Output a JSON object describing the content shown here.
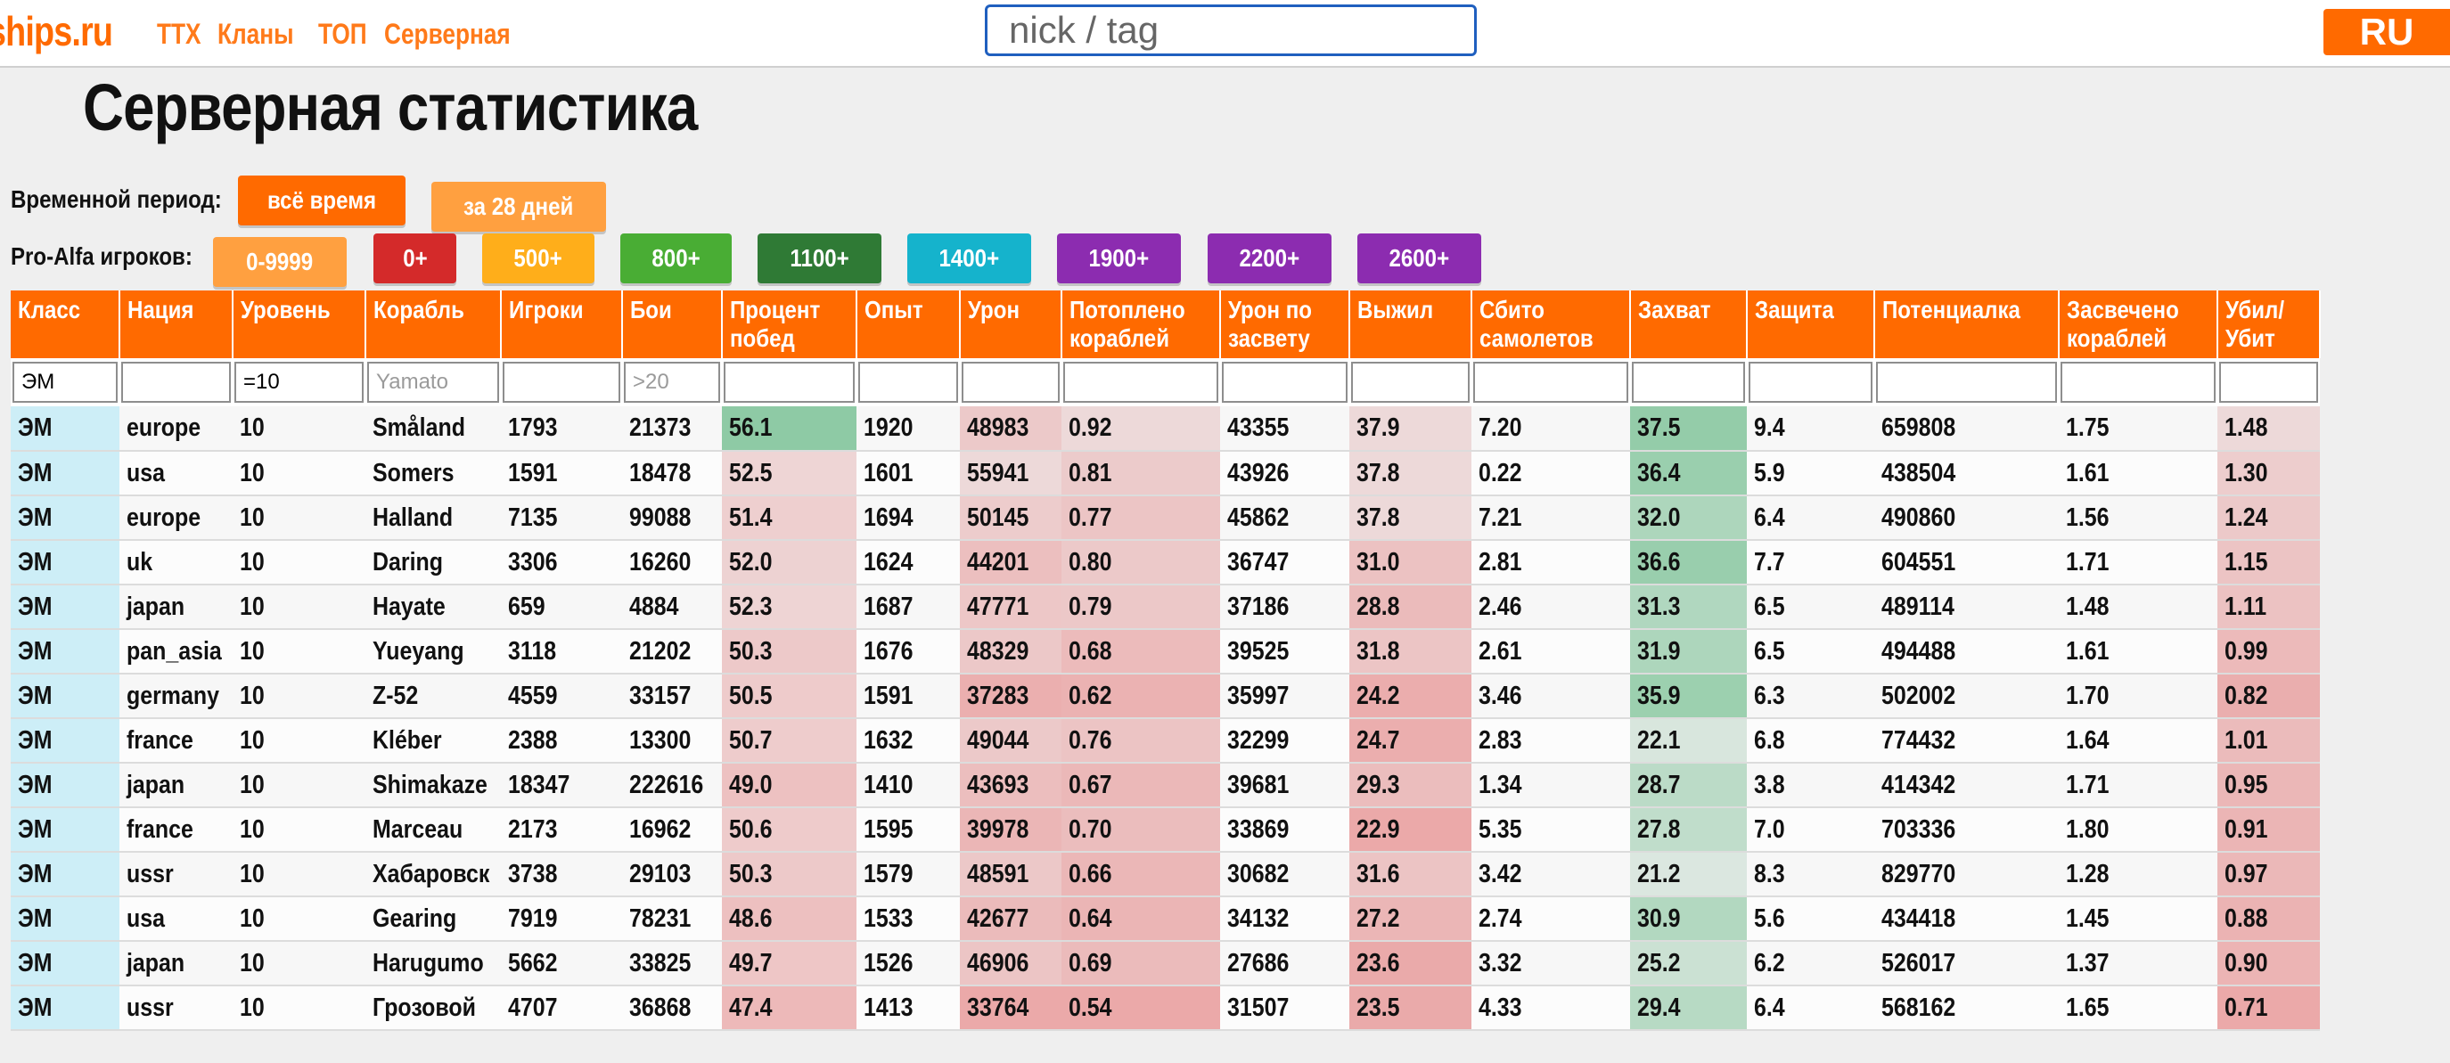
{
  "header": {
    "logo": "ships.ru",
    "nav": [
      "ТТХ",
      "Кланы",
      "ТОП",
      "Серверная"
    ],
    "search_placeholder": "nick / tag",
    "lang": "RU"
  },
  "page_title": "Серверная статистика",
  "period": {
    "label": "Временной период:",
    "options": [
      {
        "label": "всё время",
        "color": "#ff6a00",
        "selected": true
      },
      {
        "label": "за 28 дней",
        "color": "#ffa040",
        "selected": false
      }
    ]
  },
  "players": {
    "label": "Pro-Alfa игроков:",
    "options": [
      {
        "label": "0-9999",
        "color": "#ffa040"
      },
      {
        "label": "0+",
        "color": "#d42a2a"
      },
      {
        "label": "500+",
        "color": "#ffae1a"
      },
      {
        "label": "800+",
        "color": "#49ad34"
      },
      {
        "label": "1100+",
        "color": "#2f7a35"
      },
      {
        "label": "1400+",
        "color": "#15b3cc"
      },
      {
        "label": "1900+",
        "color": "#8c2cb0"
      },
      {
        "label": "2200+",
        "color": "#8c2cb0"
      },
      {
        "label": "2600+",
        "color": "#8c2cb0"
      }
    ]
  },
  "table": {
    "columns": [
      "Класс",
      "Нация",
      "Уровень",
      "Корабль",
      "Игроки",
      "Бои",
      "Процент побед",
      "Опыт",
      "Урон",
      "Потоплено кораблей",
      "Урон по засвету",
      "Выжил",
      "Сбито самолетов",
      "Захват",
      "Защита",
      "Потенциалка",
      "Засвечено кораблей",
      "Убил/ Убит"
    ],
    "filters": [
      {
        "value": "ЭМ",
        "placeholder": ""
      },
      {
        "value": "",
        "placeholder": ""
      },
      {
        "value": "=10",
        "placeholder": ""
      },
      {
        "value": "",
        "placeholder": "Yamato"
      },
      {
        "value": "",
        "placeholder": ""
      },
      {
        "value": "",
        "placeholder": ">20"
      },
      {
        "value": "",
        "placeholder": ""
      },
      {
        "value": "",
        "placeholder": ""
      },
      {
        "value": "",
        "placeholder": ""
      },
      {
        "value": "",
        "placeholder": ""
      },
      {
        "value": "",
        "placeholder": ""
      },
      {
        "value": "",
        "placeholder": ""
      },
      {
        "value": "",
        "placeholder": ""
      },
      {
        "value": "",
        "placeholder": ""
      },
      {
        "value": "",
        "placeholder": ""
      },
      {
        "value": "",
        "placeholder": ""
      },
      {
        "value": "",
        "placeholder": ""
      },
      {
        "value": "",
        "placeholder": ""
      }
    ],
    "rows": [
      [
        "ЭМ",
        "europe",
        "10",
        "Småland",
        "1793",
        "21373",
        "56.1",
        "1920",
        "48983",
        "0.92",
        "43355",
        "37.9",
        "7.20",
        "37.5",
        "9.4",
        "659808",
        "1.75",
        "1.48"
      ],
      [
        "ЭМ",
        "usa",
        "10",
        "Somers",
        "1591",
        "18478",
        "52.5",
        "1601",
        "55941",
        "0.81",
        "43926",
        "37.8",
        "0.22",
        "36.4",
        "5.9",
        "438504",
        "1.61",
        "1.30"
      ],
      [
        "ЭМ",
        "europe",
        "10",
        "Halland",
        "7135",
        "99088",
        "51.4",
        "1694",
        "50145",
        "0.77",
        "45862",
        "37.8",
        "7.21",
        "32.0",
        "6.4",
        "490860",
        "1.56",
        "1.24"
      ],
      [
        "ЭМ",
        "uk",
        "10",
        "Daring",
        "3306",
        "16260",
        "52.0",
        "1624",
        "44201",
        "0.80",
        "36747",
        "31.0",
        "2.81",
        "36.6",
        "7.7",
        "604551",
        "1.71",
        "1.15"
      ],
      [
        "ЭМ",
        "japan",
        "10",
        "Hayate",
        "659",
        "4884",
        "52.3",
        "1687",
        "47771",
        "0.79",
        "37186",
        "28.8",
        "2.46",
        "31.3",
        "6.5",
        "489114",
        "1.48",
        "1.11"
      ],
      [
        "ЭМ",
        "pan_asia",
        "10",
        "Yueyang",
        "3118",
        "21202",
        "50.3",
        "1676",
        "48329",
        "0.68",
        "39525",
        "31.8",
        "2.61",
        "31.9",
        "6.5",
        "494488",
        "1.61",
        "0.99"
      ],
      [
        "ЭМ",
        "germany",
        "10",
        "Z-52",
        "4559",
        "33157",
        "50.5",
        "1591",
        "37283",
        "0.62",
        "35997",
        "24.2",
        "3.46",
        "35.9",
        "6.3",
        "502002",
        "1.70",
        "0.82"
      ],
      [
        "ЭМ",
        "france",
        "10",
        "Kléber",
        "2388",
        "13300",
        "50.7",
        "1632",
        "49044",
        "0.76",
        "32299",
        "24.7",
        "2.83",
        "22.1",
        "6.8",
        "774432",
        "1.64",
        "1.01"
      ],
      [
        "ЭМ",
        "japan",
        "10",
        "Shimakaze",
        "18347",
        "222616",
        "49.0",
        "1410",
        "43693",
        "0.67",
        "39681",
        "29.3",
        "1.34",
        "28.7",
        "3.8",
        "414342",
        "1.71",
        "0.95"
      ],
      [
        "ЭМ",
        "france",
        "10",
        "Marceau",
        "2173",
        "16962",
        "50.6",
        "1595",
        "39978",
        "0.70",
        "33869",
        "22.9",
        "5.35",
        "27.8",
        "7.0",
        "703336",
        "1.80",
        "0.91"
      ],
      [
        "ЭМ",
        "ussr",
        "10",
        "Хабаровск",
        "3738",
        "29103",
        "50.3",
        "1579",
        "48591",
        "0.66",
        "30682",
        "31.6",
        "3.42",
        "21.2",
        "8.3",
        "829770",
        "1.28",
        "0.97"
      ],
      [
        "ЭМ",
        "usa",
        "10",
        "Gearing",
        "7919",
        "78231",
        "48.6",
        "1533",
        "42677",
        "0.64",
        "34132",
        "27.2",
        "2.74",
        "30.9",
        "5.6",
        "434418",
        "1.45",
        "0.88"
      ],
      [
        "ЭМ",
        "japan",
        "10",
        "Harugumo",
        "5662",
        "33825",
        "49.7",
        "1526",
        "46906",
        "0.69",
        "27686",
        "23.6",
        "3.32",
        "25.2",
        "6.2",
        "526017",
        "1.37",
        "0.90"
      ],
      [
        "ЭМ",
        "ussr",
        "10",
        "Грозовой",
        "4707",
        "36868",
        "47.4",
        "1413",
        "33764",
        "0.54",
        "31507",
        "23.5",
        "4.33",
        "29.4",
        "6.4",
        "568162",
        "1.65",
        "0.71"
      ]
    ]
  }
}
